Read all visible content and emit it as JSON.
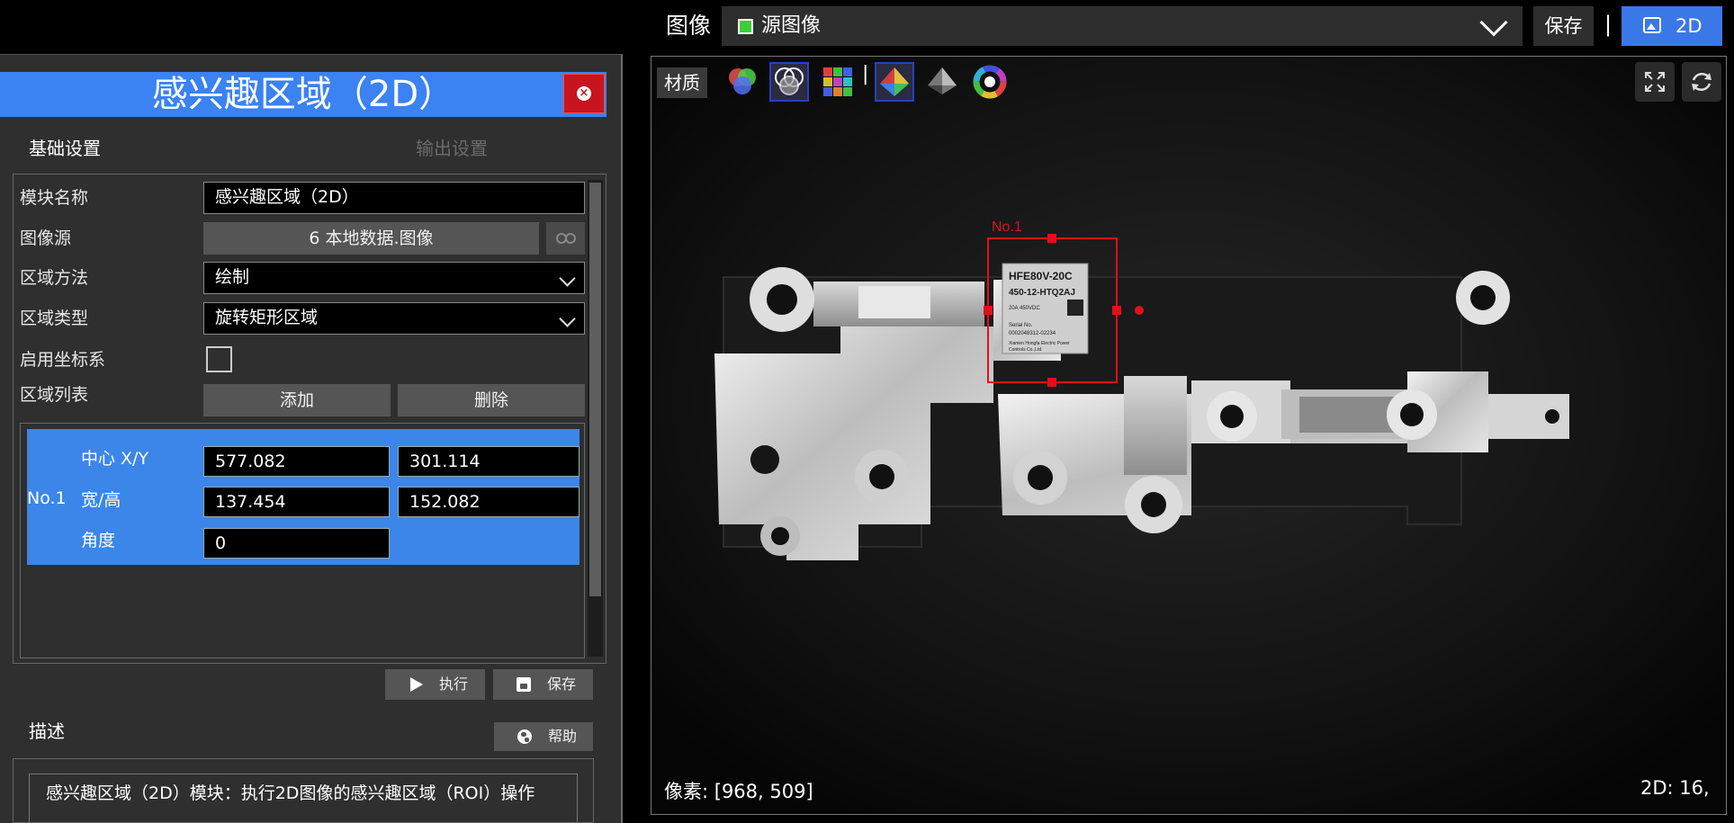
{
  "window": {
    "title": "感兴趣区域（2D）"
  },
  "tabs": {
    "basic": "基础设置",
    "output": "输出设置"
  },
  "form": {
    "module_name_label": "模块名称",
    "module_name_value": "感兴趣区域（2D）",
    "image_source_label": "图像源",
    "image_source_value": "6 本地数据.图像",
    "region_method_label": "区域方法",
    "region_method_value": "绘制",
    "region_type_label": "区域类型",
    "region_type_value": "旋转矩形区域",
    "coord_label": "启用坐标系",
    "coord_checked": false,
    "region_list_label": "区域列表",
    "add_label": "添加",
    "delete_label": "删除"
  },
  "roi": {
    "name": "No.1",
    "center_label": "中心 X/Y",
    "center_x": "577.082",
    "center_y": "301.114",
    "size_label": "宽/高",
    "width": "137.454",
    "height": "152.082",
    "angle_label": "角度",
    "angle": "0"
  },
  "actions": {
    "run_label": "执行",
    "save_label": "保存"
  },
  "description": {
    "label": "描述",
    "help_label": "帮助",
    "text": "感兴趣区域（2D）模块：执行2D图像的感兴趣区域（ROI）操作"
  },
  "topbar": {
    "image_label": "图像",
    "source_value": "源图像",
    "save_label": "保存",
    "separator": "|",
    "view_mode": "2D"
  },
  "viewer": {
    "material_label": "材质",
    "tool_separator": "|",
    "roi_overlay_label": "No.1",
    "pixel_status": "像素: [968, 509]",
    "mode_status": "2D: 16,",
    "chip_text_lines": [
      "HFE80V-20C",
      "450-12-HTQ2AJ",
      "20A 450VDC",
      "Serial No.",
      "0002048312-02234",
      "Xiamen Hongfa Electric Power",
      "Controls Co.,Ltd."
    ],
    "tools": [
      "rgb-channels-icon",
      "channel-overlay-icon",
      "pixel-grid-icon",
      "color-map-icon",
      "shaded-mesh-icon",
      "color-wheel-icon"
    ]
  },
  "colors": {
    "accent_blue": "#3b82f2",
    "close_red": "#c8141e",
    "roi_red": "#e0101a",
    "source_green": "#39d039"
  }
}
